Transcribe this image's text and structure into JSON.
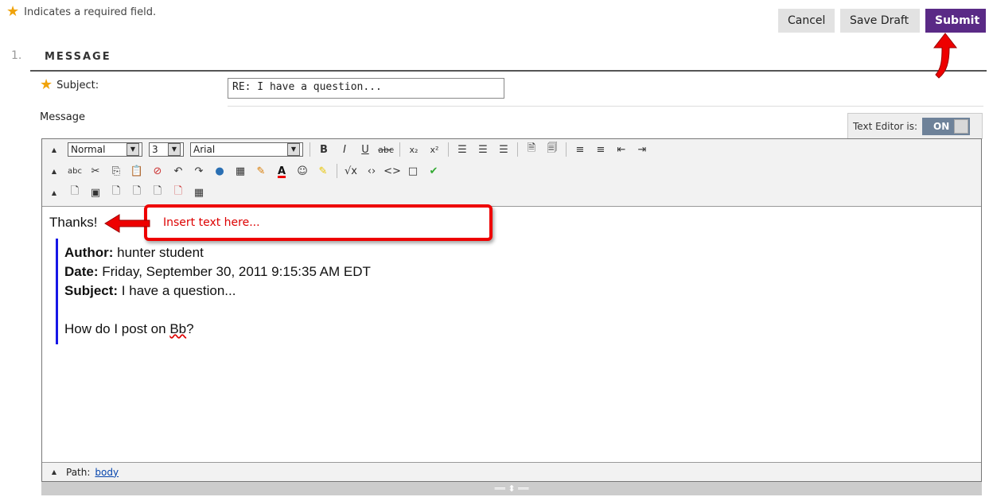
{
  "required_note": "Indicates a required field.",
  "buttons": {
    "cancel": "Cancel",
    "save_draft": "Save Draft",
    "submit": "Submit"
  },
  "section": {
    "number": "1.",
    "title": "MESSAGE"
  },
  "subject": {
    "label": "Subject:",
    "value": "RE: I have a question..."
  },
  "message_label": "Message",
  "text_editor": {
    "label": "Text Editor is:",
    "state": "ON"
  },
  "toolbar": {
    "format": "Normal",
    "size": "3",
    "font": "Arial"
  },
  "body": {
    "first_line": "Thanks!",
    "quote": {
      "author_label": "Author:",
      "author": "hunter student",
      "date_label": "Date:",
      "date": "Friday, September 30, 2011 9:15:35 AM EDT",
      "subject_label": "Subject:",
      "subject": "I have a question...",
      "question_pre": "How do I post on ",
      "question_word": "Bb",
      "question_post": "?"
    }
  },
  "path": {
    "label": "Path:",
    "value": "body"
  },
  "annotation": {
    "callout": "Insert text here..."
  },
  "colors": {
    "submit": "#5a2a86",
    "annotation": "#e00000",
    "quote_bar": "#1717e6",
    "star": "#f0a30a"
  }
}
